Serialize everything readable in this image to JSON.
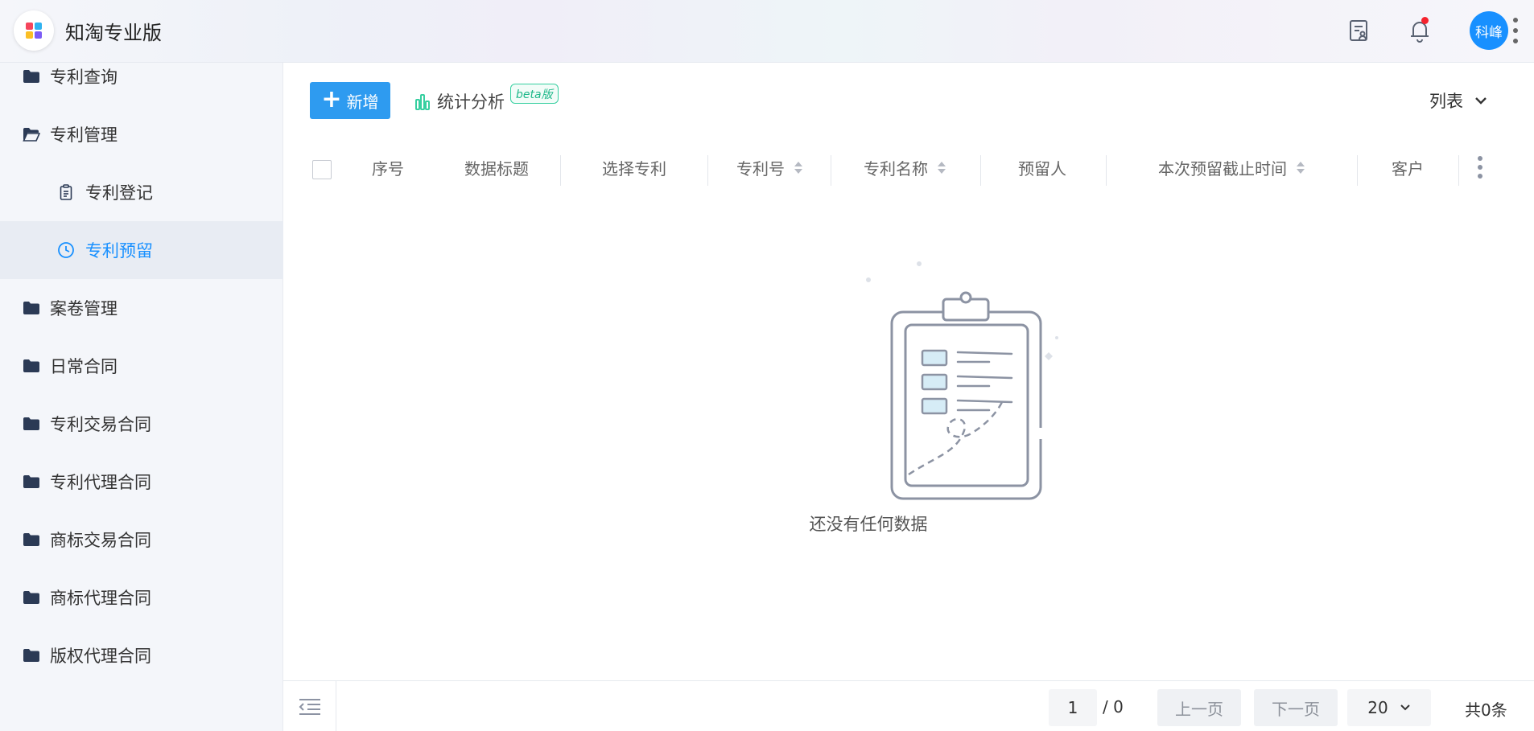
{
  "header": {
    "app_title": "知淘专业版",
    "avatar_text": "科峰",
    "logo_colors": [
      "#f5455c",
      "#2fb2f0",
      "#fbbf24",
      "#22c55e"
    ],
    "notification_dot_color": "#f5222d",
    "icons": [
      "app-logo-icon",
      "document-user-icon",
      "bell-icon",
      "more-vertical-icon"
    ]
  },
  "sidebar": {
    "items": [
      {
        "label": "专利查询",
        "icon": "folder-icon",
        "level": 1
      },
      {
        "label": "专利管理",
        "icon": "folder-open-icon",
        "level": 1
      },
      {
        "label": "专利登记",
        "icon": "clipboard-icon",
        "level": 2
      },
      {
        "label": "专利预留",
        "icon": "clock-icon",
        "level": 2,
        "active": true
      },
      {
        "label": "案卷管理",
        "icon": "folder-icon",
        "level": 1
      },
      {
        "label": "日常合同",
        "icon": "folder-icon",
        "level": 1
      },
      {
        "label": "专利交易合同",
        "icon": "folder-icon",
        "level": 1
      },
      {
        "label": "专利代理合同",
        "icon": "folder-icon",
        "level": 1
      },
      {
        "label": "商标交易合同",
        "icon": "folder-icon",
        "level": 1
      },
      {
        "label": "商标代理合同",
        "icon": "folder-icon",
        "level": 1
      },
      {
        "label": "版权代理合同",
        "icon": "folder-icon",
        "level": 1
      }
    ]
  },
  "toolbar": {
    "add_label": "新增",
    "stats_label": "统计分析",
    "beta_label": "beta版",
    "view_label": "列表"
  },
  "table": {
    "columns": [
      {
        "label": "序号",
        "sortable": false
      },
      {
        "label": "数据标题",
        "sortable": false
      },
      {
        "label": "选择专利",
        "sortable": false
      },
      {
        "label": "专利号",
        "sortable": true
      },
      {
        "label": "专利名称",
        "sortable": true
      },
      {
        "label": "预留人",
        "sortable": false
      },
      {
        "label": "本次预留截止时间",
        "sortable": true
      },
      {
        "label": "客户",
        "sortable": false
      }
    ],
    "rows": [],
    "empty_text": "还没有任何数据"
  },
  "pagination": {
    "current_page": "1",
    "total_pages_text": "/ 0",
    "prev_label": "上一页",
    "next_label": "下一页",
    "page_size": "20",
    "total_text": "共0条"
  },
  "colors": {
    "accent": "#1890ff",
    "add_button": "#2e9bf0",
    "beta": "#1fb88a",
    "sidebar_bg": "#f4f6fa",
    "sidebar_icon": "#2b3a55"
  }
}
